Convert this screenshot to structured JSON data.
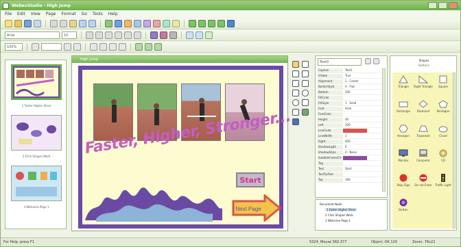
{
  "window": {
    "title": "WebexStudio - High Jump"
  },
  "menu": [
    "File",
    "Edit",
    "View",
    "Page",
    "Format",
    "Go",
    "Tools",
    "Help"
  ],
  "toolbar": {
    "font_name": "Arial",
    "font_size": "10",
    "zoom": "100%"
  },
  "thumbnails": [
    {
      "caption": "1 Faster Higher Stron"
    },
    {
      "caption": "2 Click Shapes Work"
    },
    {
      "caption": "3 Welcome Page 1"
    }
  ],
  "document": {
    "title": "High Jump",
    "slide_text": "Faster, Higher, Stronger...",
    "start_label": "Start",
    "next_label": "Next Page"
  },
  "properties": {
    "object": "Text0",
    "rows": [
      {
        "k": "Caption",
        "v": "Text1"
      },
      {
        "k": "Visible",
        "v": "True"
      },
      {
        "k": "Alignment",
        "v": "1 - Center"
      },
      {
        "k": "BorderStyle",
        "v": "0 - Flat"
      },
      {
        "k": "Bottom",
        "v": "200"
      },
      {
        "k": "FillColor",
        "v": ""
      },
      {
        "k": "FillStyle",
        "v": "1 - Solid"
      },
      {
        "k": "Font",
        "v": "Arial"
      },
      {
        "k": "ForeColor",
        "v": ""
      },
      {
        "k": "Height",
        "v": "40"
      },
      {
        "k": "Left",
        "v": "200"
      },
      {
        "k": "LineColor",
        "v": ""
      },
      {
        "k": "LineWidth",
        "v": "1"
      },
      {
        "k": "Right",
        "v": "400"
      },
      {
        "k": "ShadowLight",
        "v": "0"
      },
      {
        "k": "ShadowStyle",
        "v": "0 - None"
      },
      {
        "k": "SubtitleFrameClr",
        "v": ""
      },
      {
        "k": "Tag",
        "v": ""
      },
      {
        "k": "Text",
        "v": "Start"
      },
      {
        "k": "ToolTipText",
        "v": ""
      },
      {
        "k": "Top",
        "v": "160"
      }
    ]
  },
  "tree": {
    "root": "Document Node",
    "items": [
      "1 Faster Higher Stron",
      "2 Click Shapes Work",
      "3 Welcome Page 1"
    ]
  },
  "gallery": {
    "header": "Shapes",
    "subheader": "Buttons",
    "items": [
      "Triangle",
      "Right Triangle",
      "Square",
      "Rectangle",
      "Diamond",
      "Pentagon",
      "Hexagon",
      "Trapezoid",
      "Cloud",
      "Monitor",
      "Computer",
      "CD",
      "Stop Sign",
      "Do not Enter",
      "Traffic Light",
      "Button"
    ]
  },
  "status": {
    "left": "For Help, press F1",
    "coords": "5324, Mouse 560,377",
    "obj": "Object: OK  120",
    "zoom": "Zoom: 76x22"
  },
  "colors": {
    "accent": "#6bb04a",
    "slide_border": "#6b4aa3",
    "slide_text": "#c35ec4"
  }
}
